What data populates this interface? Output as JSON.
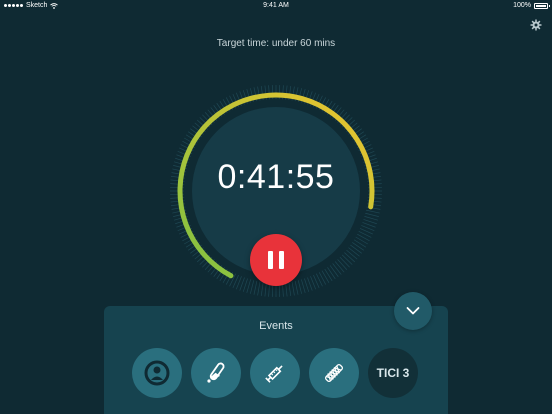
{
  "status_bar": {
    "carrier": "Sketch",
    "time": "9:41 AM",
    "battery": "100%"
  },
  "header": {
    "target_time": "Target time: under 60 mins"
  },
  "timer": {
    "elapsed": "0:41:55",
    "progress": 0.6986
  },
  "events": {
    "title": "Events",
    "items": [
      {
        "icon": "imaging-scanner-icon"
      },
      {
        "icon": "test-tube-icon"
      },
      {
        "icon": "syringe-icon"
      },
      {
        "icon": "stent-icon"
      },
      {
        "label": "TICI 3"
      }
    ]
  },
  "colors": {
    "background": "#0f2a33",
    "pause_button": "#e8333a",
    "arc_start": "#7ec242",
    "arc_end": "#f2c52e",
    "event_button": "#2a6f7e"
  }
}
